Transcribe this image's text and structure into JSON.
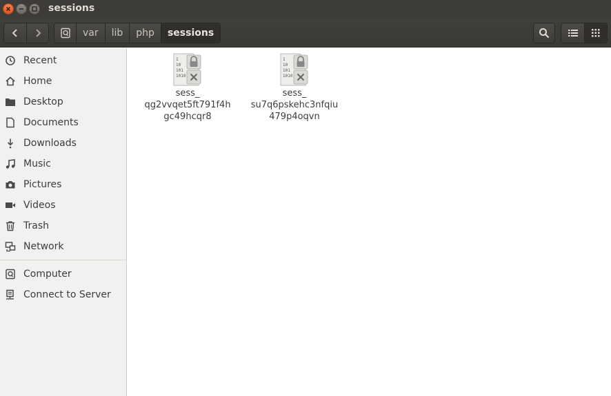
{
  "window": {
    "title": "sessions"
  },
  "pathbar": {
    "segments": [
      "var",
      "lib",
      "php",
      "sessions"
    ]
  },
  "sidebar": {
    "places": [
      {
        "label": "Recent",
        "icon": "recent-icon"
      },
      {
        "label": "Home",
        "icon": "home-icon"
      },
      {
        "label": "Desktop",
        "icon": "desktop-folder-icon"
      },
      {
        "label": "Documents",
        "icon": "documents-icon"
      },
      {
        "label": "Downloads",
        "icon": "downloads-icon"
      },
      {
        "label": "Music",
        "icon": "music-icon"
      },
      {
        "label": "Pictures",
        "icon": "pictures-icon"
      },
      {
        "label": "Videos",
        "icon": "videos-icon"
      },
      {
        "label": "Trash",
        "icon": "trash-icon"
      },
      {
        "label": "Network",
        "icon": "network-icon"
      }
    ],
    "devices": [
      {
        "label": "Computer",
        "icon": "computer-icon"
      },
      {
        "label": "Connect to Server",
        "icon": "connect-server-icon"
      }
    ]
  },
  "files": [
    {
      "line1": "sess_",
      "line2": "qg2vvqet5ft791f4h",
      "line3": "gc49hcqr8",
      "icon": "binary-file-locked-icon"
    },
    {
      "line1": "sess_",
      "line2": "su7q6pskehc3nfqiu",
      "line3": "479p4oqvn",
      "icon": "binary-file-locked-icon"
    }
  ],
  "colors": {
    "titlebar": "#3d3c38",
    "sidebar": "#f1f1f0",
    "close_button": "#e95420",
    "text": "#3c3c3c"
  }
}
